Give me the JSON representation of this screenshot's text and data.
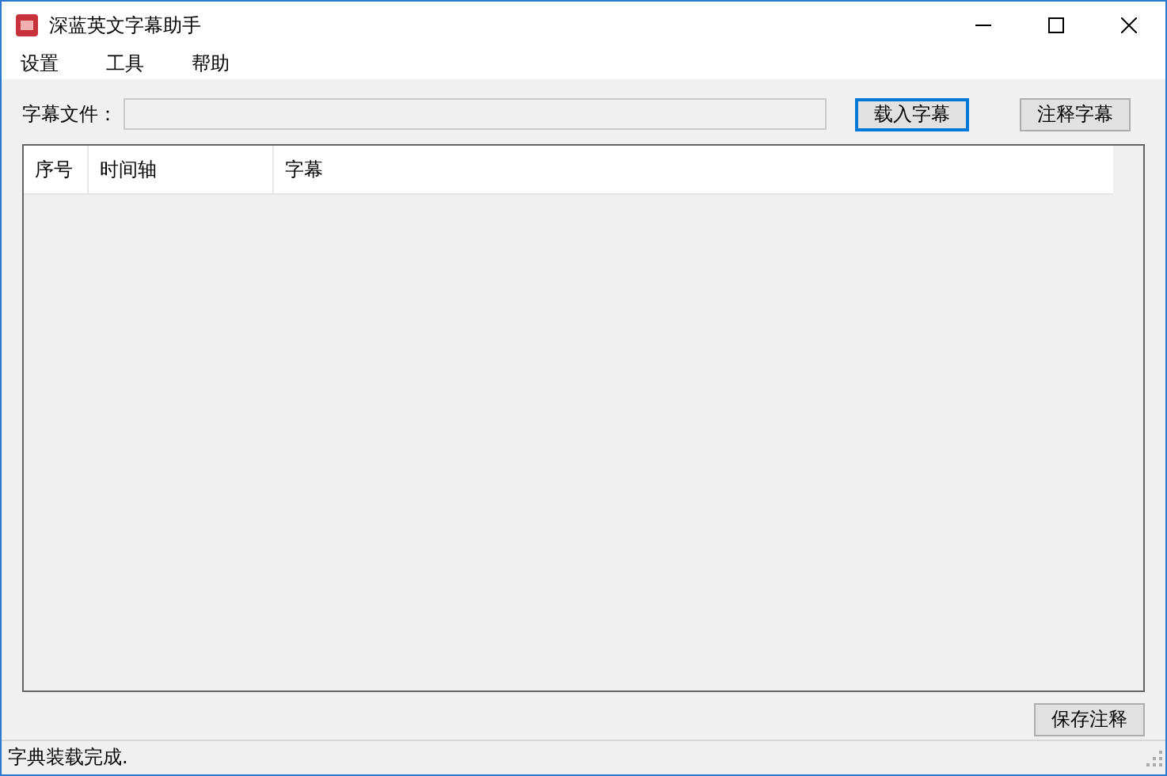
{
  "window": {
    "title": "深蓝英文字幕助手"
  },
  "menu": [
    "设置",
    "工具",
    "帮助"
  ],
  "file_row": {
    "label": "字幕文件：",
    "buttons": [
      {
        "label": "载入字幕",
        "selected": true
      },
      {
        "label": "注释字幕",
        "selected": false
      }
    ]
  },
  "table": {
    "columns": [
      "序号",
      "时间轴",
      "字幕"
    ]
  },
  "save_button": "保存注释",
  "status_bar": "字典装载完成."
}
